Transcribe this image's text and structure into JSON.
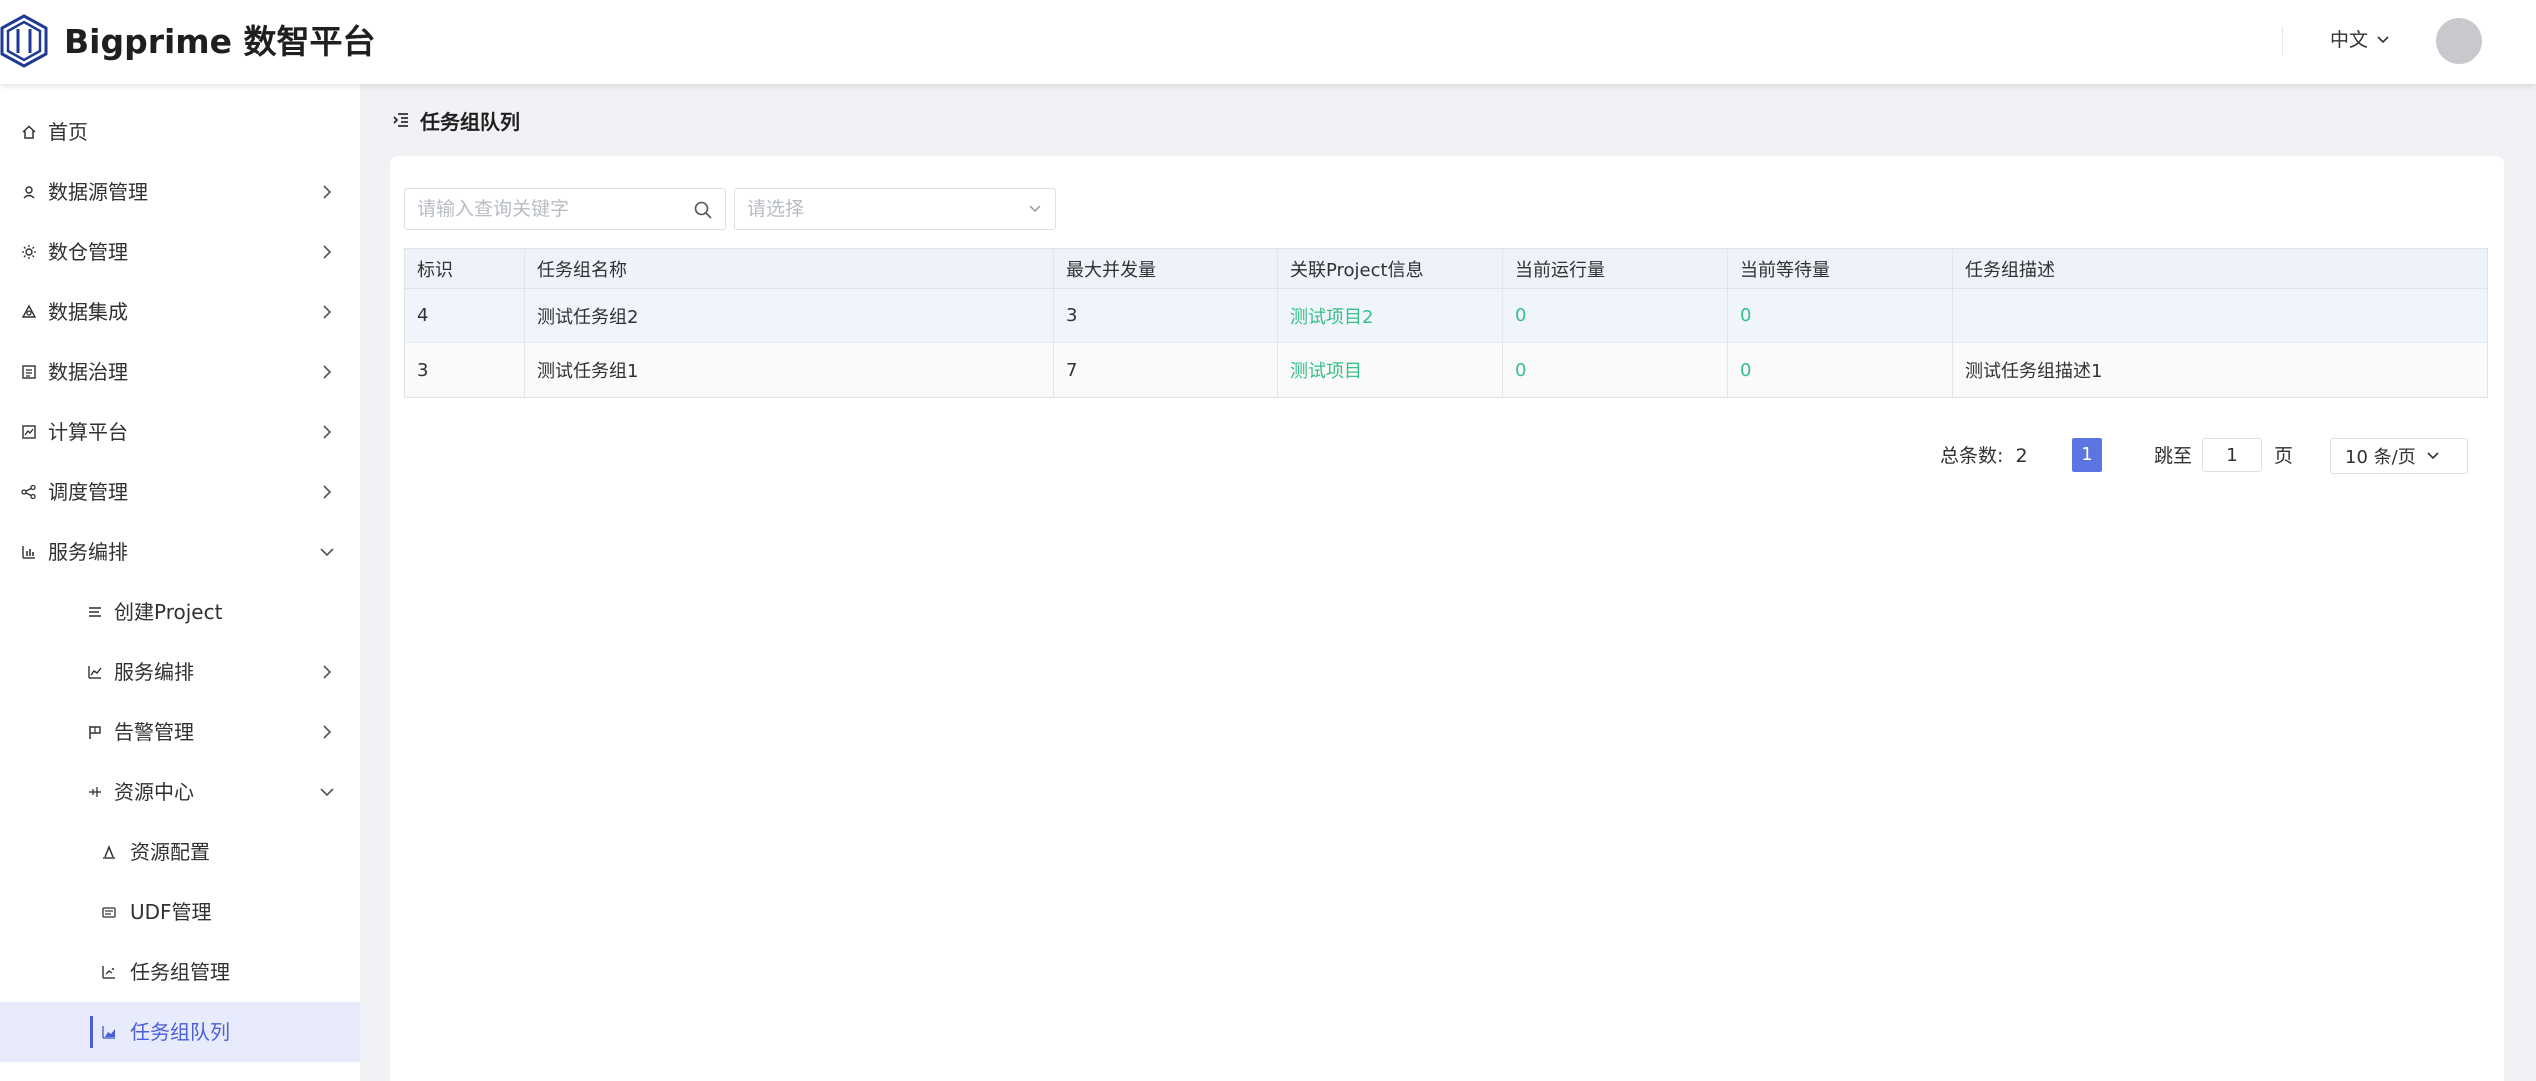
{
  "header": {
    "app_title": "Bigprime 数智平台",
    "language": "中文"
  },
  "sidebar": {
    "items": [
      {
        "label": "首页",
        "icon": "home-icon"
      },
      {
        "label": "数据源管理",
        "icon": "datasource-icon"
      },
      {
        "label": "数仓管理",
        "icon": "warehouse-icon"
      },
      {
        "label": "数据集成",
        "icon": "integration-icon"
      },
      {
        "label": "数据治理",
        "icon": "governance-icon"
      },
      {
        "label": "计算平台",
        "icon": "compute-icon"
      },
      {
        "label": "调度管理",
        "icon": "schedule-icon"
      },
      {
        "label": "服务编排",
        "icon": "bar-chart-icon"
      },
      {
        "label": "创建Project",
        "icon": "list-icon"
      },
      {
        "label": "服务编排",
        "icon": "line-chart-icon"
      },
      {
        "label": "告警管理",
        "icon": "flag-icon"
      },
      {
        "label": "资源中心",
        "icon": "resource-icon"
      },
      {
        "label": "资源配置",
        "icon": "config-icon"
      },
      {
        "label": "UDF管理",
        "icon": "udf-icon"
      },
      {
        "label": "任务组管理",
        "icon": "task-group-icon"
      },
      {
        "label": "任务组队列",
        "icon": "task-queue-icon"
      }
    ]
  },
  "page": {
    "title": "任务组队列",
    "search_placeholder": "请输入查询关键字",
    "select_placeholder": "请选择"
  },
  "table": {
    "columns": [
      "标识",
      "任务组名称",
      "最大并发量",
      "关联Project信息",
      "当前运行量",
      "当前等待量",
      "任务组描述"
    ],
    "rows": [
      {
        "id": "4",
        "name": "测试任务组2",
        "max": "3",
        "project": "测试项目2",
        "running": "0",
        "waiting": "0",
        "desc": ""
      },
      {
        "id": "3",
        "name": "测试任务组1",
        "max": "7",
        "project": "测试项目",
        "running": "0",
        "waiting": "0",
        "desc": "测试任务组描述1"
      }
    ]
  },
  "pagination": {
    "total_label": "总条数:",
    "total": "2",
    "current_page": "1",
    "jump_label": "跳至",
    "jump_value": "1",
    "page_suffix": "页",
    "page_size": "10 条/页"
  },
  "colors": {
    "accent": "#4a5fd8",
    "link_green": "#36c08a"
  }
}
